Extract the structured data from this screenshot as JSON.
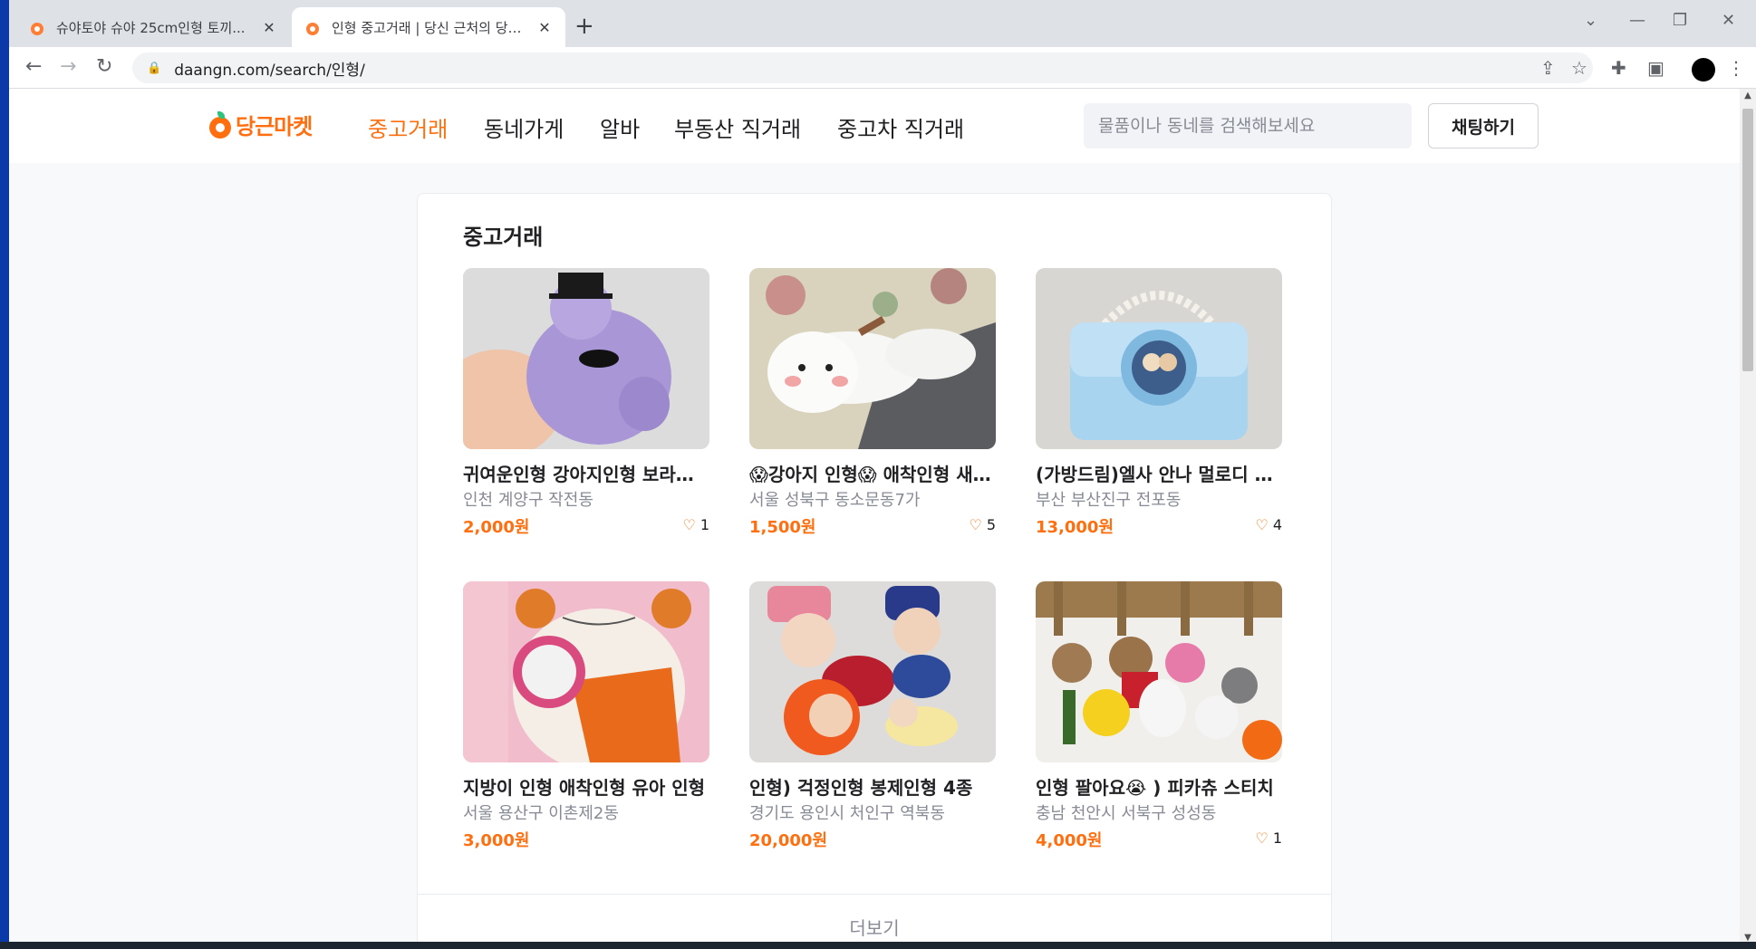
{
  "browser": {
    "tabs": [
      {
        "title": "슈야토야 슈야 25cm인형 토끼...",
        "active": false
      },
      {
        "title": "인형 중고거래 | 당신 근처의 당근마켓",
        "active": true
      }
    ],
    "new_tab": "+",
    "url": "daangn.com/search/인형/"
  },
  "site": {
    "logo_text": "당근마켓",
    "nav": [
      "중고거래",
      "동네가게",
      "알바",
      "부동산 직거래",
      "중고차 직거래"
    ],
    "active_nav": 0,
    "search_placeholder": "물품이나 동네를 검색해보세요",
    "chat_button": "채팅하기",
    "brand_color": "#ff6f0f"
  },
  "section": {
    "title": "중고거래",
    "more_label": "더보기",
    "items": [
      {
        "title": "귀여운인형 강아지인형 보라색 곰돌이",
        "location": "인천 계양구 작전동",
        "price": "2,000원",
        "likes": "1"
      },
      {
        "title": "😱강아지 인형😱 애착인형 새상품",
        "location": "서울 성북구 동소문동7가",
        "price": "1,500원",
        "likes": "5"
      },
      {
        "title": "(가방드림)엘사 안나 멀로디 가방",
        "location": "부산 부산진구 전포동",
        "price": "13,000원",
        "likes": "4"
      },
      {
        "title": "지방이 인형 애착인형 유아 인형",
        "location": "서울 용산구 이촌제2동",
        "price": "3,000원",
        "likes": ""
      },
      {
        "title": "인형) 걱정인형 봉제인형 4종",
        "location": "경기도 용인시 처인구 역북동",
        "price": "20,000원",
        "likes": ""
      },
      {
        "title": "인형 팔아요😭 ) 피카츄 스티치",
        "location": "충남 천안시 서북구 성성동",
        "price": "4,000원",
        "likes": "1"
      }
    ]
  }
}
